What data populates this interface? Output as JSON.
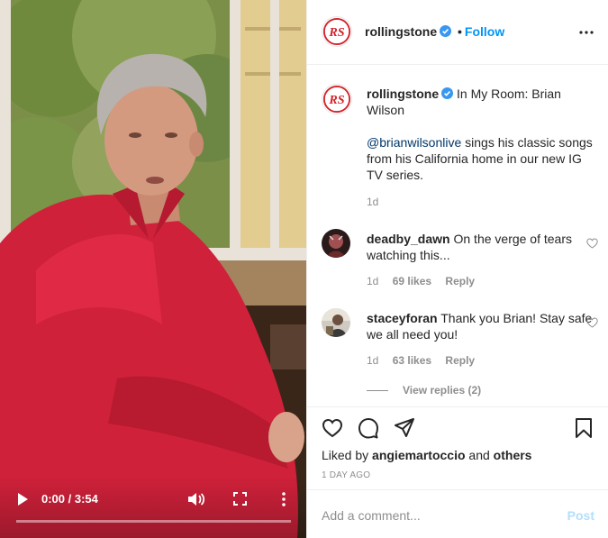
{
  "video": {
    "time_display": "0:00 / 3:54",
    "progress_fraction": 0.0
  },
  "account": {
    "username": "rollingstone",
    "follow_label": "Follow",
    "dot": "•"
  },
  "caption": {
    "username": "rollingstone",
    "title": "In My Room: Brian Wilson",
    "mention": "@brianwilsonlive",
    "body": "sings his classic songs from his California home in our new IG TV series.",
    "age": "1d"
  },
  "comments": [
    {
      "username": "deadby_dawn",
      "text": "On the verge of tears watching this...",
      "age": "1d",
      "likes": "69 likes",
      "reply_label": "Reply"
    },
    {
      "username": "staceyforan",
      "text": "Thank you Brian! Stay safe we all need you!",
      "age": "1d",
      "likes": "63 likes",
      "reply_label": "Reply"
    }
  ],
  "view_replies": "View replies (2)",
  "liked_by": {
    "prefix": "Liked by",
    "user": "angiemartoccio",
    "conjunction": "and",
    "others": "others"
  },
  "post_time": "1 DAY AGO",
  "add_comment": {
    "placeholder": "Add a comment...",
    "post_label": "Post"
  },
  "icons": {
    "verified": "verified-badge-icon",
    "options": "more-horizontal-icon",
    "like": "heart-icon",
    "comment": "comment-bubble-icon",
    "share": "paper-plane-icon",
    "save": "bookmark-icon",
    "play": "play-icon",
    "volume": "volume-icon",
    "fullscreen": "fullscreen-icon",
    "video_menu": "more-vertical-icon"
  },
  "colors": {
    "brand_red": "#d3222a",
    "link_blue": "#0095f6",
    "mention_blue": "#00376b",
    "muted_gray": "#8e8e8e",
    "post_disabled": "#b2dffc"
  }
}
